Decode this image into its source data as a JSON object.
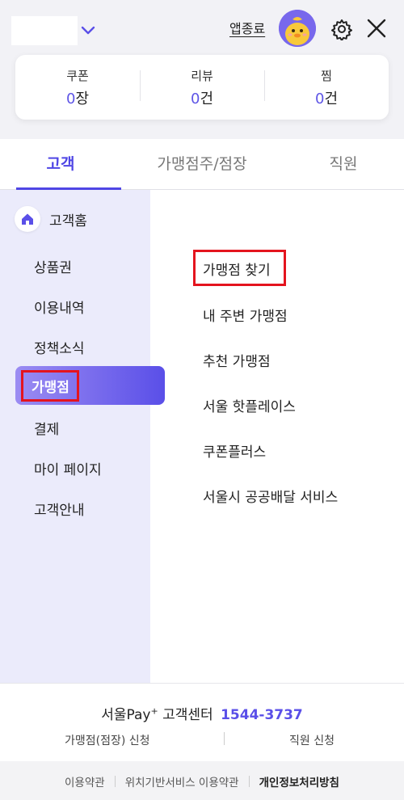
{
  "header": {
    "end_app_label": "앱종료",
    "accent_color": "#4f46e5"
  },
  "stats": [
    {
      "label": "쿠폰",
      "value": "0",
      "unit": "장"
    },
    {
      "label": "리뷰",
      "value": "0",
      "unit": "건"
    },
    {
      "label": "찜",
      "value": "0",
      "unit": "건"
    }
  ],
  "tabs": [
    {
      "label": "고객",
      "active": true
    },
    {
      "label": "가맹점주/점장",
      "active": false
    },
    {
      "label": "직원",
      "active": false
    }
  ],
  "sidebar": {
    "home_label": "고객홈",
    "items": [
      {
        "label": "상품권"
      },
      {
        "label": "이용내역"
      },
      {
        "label": "정책소식"
      },
      {
        "label": "가맹점",
        "active": true
      },
      {
        "label": "결제"
      },
      {
        "label": "마이 페이지"
      },
      {
        "label": "고객안내"
      }
    ]
  },
  "submenu": {
    "items": [
      {
        "label": "가맹점 찾기",
        "highlighted": true
      },
      {
        "label": "내 주변 가맹점"
      },
      {
        "label": "추천 가맹점"
      },
      {
        "label": "서울 핫플레이스"
      },
      {
        "label": "쿠폰플러스"
      },
      {
        "label": "서울시 공공배달 서비스"
      }
    ]
  },
  "footer": {
    "service_name": "서울Pay",
    "service_sup": "+",
    "center_label": "고객센터",
    "phone": "1544-3737",
    "merchant_apply": "가맹점(점장) 신청",
    "staff_apply": "직원 신청",
    "legal": [
      "이용약관",
      "위치기반서비스 이용약관",
      "개인정보처리방침"
    ]
  }
}
